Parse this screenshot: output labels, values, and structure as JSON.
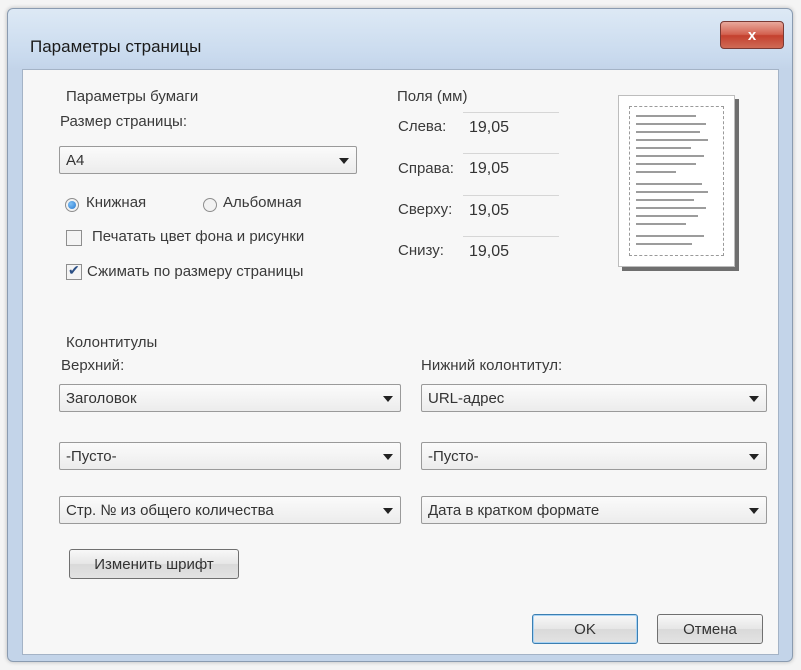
{
  "window": {
    "title": "Параметры страницы",
    "close_label": "x"
  },
  "paper": {
    "heading": "Параметры бумаги",
    "size_label": "Размер страницы:",
    "size_value": "A4",
    "orientation_portrait": "Книжная",
    "orientation_landscape": "Альбомная",
    "print_background_label": "Печатать цвет фона и рисунки",
    "print_background_checked": false,
    "shrink_to_fit_label": "Сжимать по размеру страницы",
    "shrink_to_fit_checked": true
  },
  "margins": {
    "heading": "Поля (мм)",
    "left_label": "Слева:",
    "left_value": "19,05",
    "right_label": "Справа:",
    "right_value": "19,05",
    "top_label": "Сверху:",
    "top_value": "19,05",
    "bottom_label": "Снизу:",
    "bottom_value": "19,05"
  },
  "headers_footers": {
    "heading": "Колонтитулы",
    "header_label": "Верхний:",
    "footer_label": "Нижний колонтитул:",
    "header_1": "Заголовок",
    "header_2": "-Пусто-",
    "header_3": "Стр. № из общего количества",
    "footer_1": "URL-адрес",
    "footer_2": "-Пусто-",
    "footer_3": "Дата в кратком формате",
    "change_font_button": "Изменить шрифт"
  },
  "buttons": {
    "ok": "OK",
    "cancel": "Отмена"
  },
  "icons": {
    "close": "close-icon",
    "dropdown": "chevron-down-icon"
  }
}
